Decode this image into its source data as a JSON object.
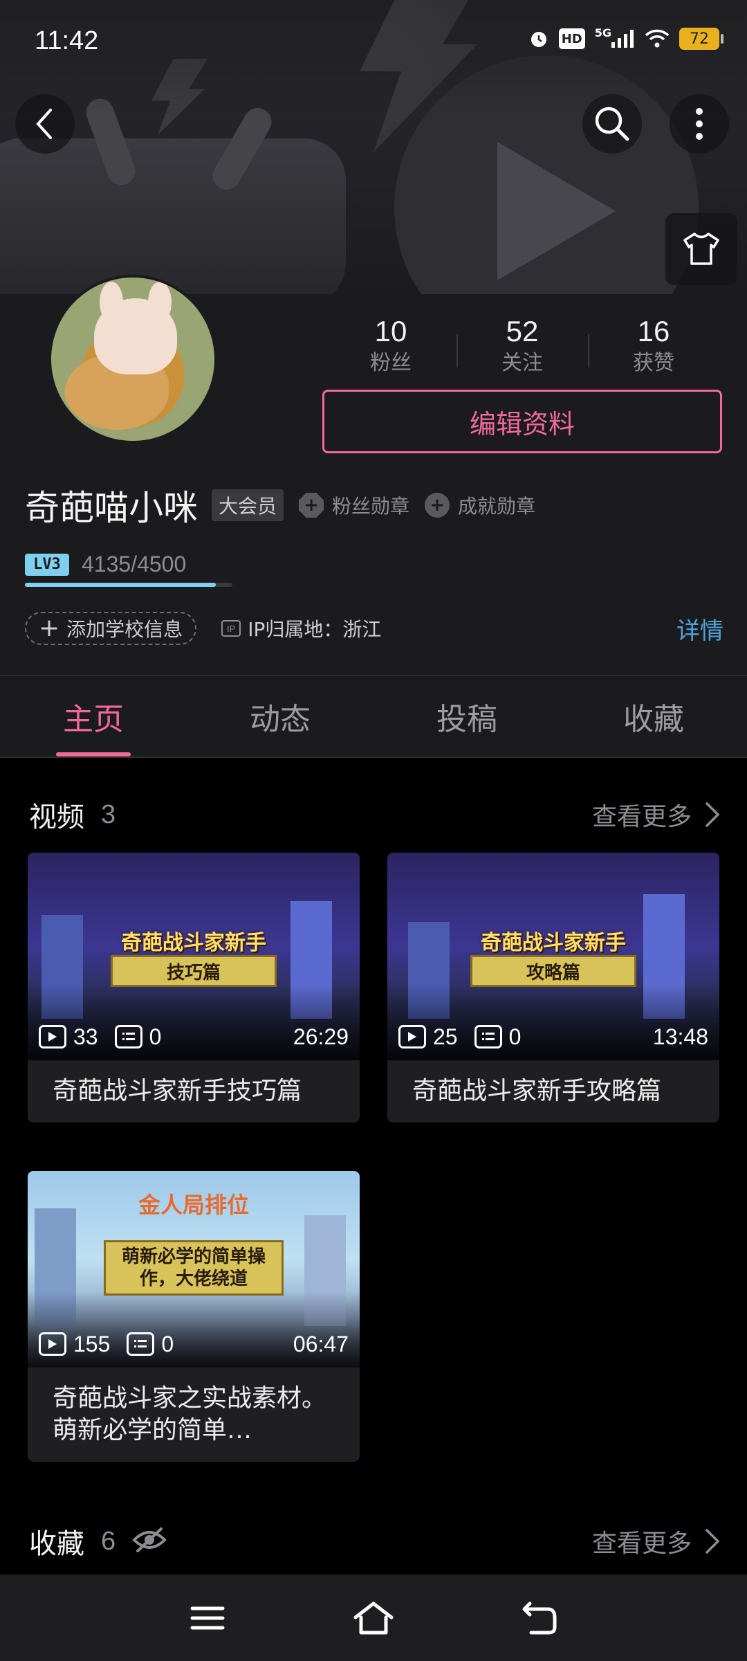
{
  "status_bar": {
    "time": "11:42",
    "network": "5G",
    "hd": "HD",
    "battery": "72"
  },
  "header": {
    "back_icon": "chevron-left-icon",
    "search_icon": "search-icon",
    "more_icon": "more-vertical-icon",
    "theme_icon": "tshirt-icon"
  },
  "profile": {
    "username": "奇葩喵小咪",
    "vip_label": "大会员",
    "fans_medal": "粉丝勋章",
    "achievement_medal": "成就勋章",
    "stats": [
      {
        "value": "10",
        "label": "粉丝"
      },
      {
        "value": "52",
        "label": "关注"
      },
      {
        "value": "16",
        "label": "获赞"
      }
    ],
    "edit_button": "编辑资料",
    "level_badge": "LV3",
    "exp_text": "4135/4500",
    "exp_fraction": 0.9189,
    "add_school": "添加学校信息",
    "ip_badge": "IP",
    "ip_location": "IP归属地：浙江",
    "detail_link": "详情"
  },
  "tabs": [
    {
      "label": "主页",
      "active": true
    },
    {
      "label": "动态",
      "active": false
    },
    {
      "label": "投稿",
      "active": false
    },
    {
      "label": "收藏",
      "active": false
    }
  ],
  "videos_section": {
    "title": "视频",
    "count": "3",
    "more": "查看更多",
    "items": [
      {
        "title": "奇葩战斗家新手技巧篇",
        "thumb_text": "奇葩战斗家新手技巧篇",
        "views": "33",
        "comments": "0",
        "duration": "26:29"
      },
      {
        "title": "奇葩战斗家新手攻略篇",
        "thumb_text": "奇葩战斗家新手攻略篇",
        "views": "25",
        "comments": "0",
        "duration": "13:48"
      },
      {
        "title": "奇葩战斗家之实战素材。萌新必学的简单…",
        "thumb_text": "金人局排位",
        "thumb_sub": "萌新必学的简单操作，大佬绕道",
        "views": "155",
        "comments": "0",
        "duration": "06:47"
      }
    ]
  },
  "favorites_section": {
    "title": "收藏",
    "count": "6",
    "visibility_icon": "eye-off-icon",
    "more": "查看更多"
  },
  "navbar": {
    "menu_icon": "menu-icon",
    "home_icon": "home-icon",
    "back_icon": "back-icon"
  },
  "colors": {
    "accent": "#f06a98",
    "link": "#4ea4d9",
    "level": "#7fd0ef"
  }
}
